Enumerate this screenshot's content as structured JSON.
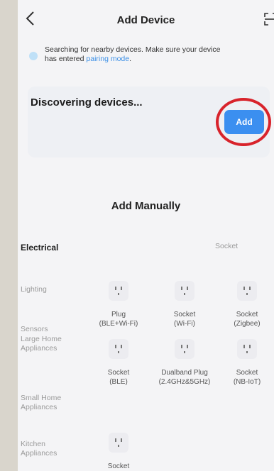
{
  "header": {
    "title": "Add Device"
  },
  "notice": {
    "text_prefix": "Searching for nearby devices. Make sure your device",
    "text_line2_prefix": "has entered ",
    "link": "pairing mode",
    "text_line2_suffix": "."
  },
  "discovery": {
    "title": "Discovering devices...",
    "add_label": "Add"
  },
  "manual": {
    "title": "Add Manually",
    "selected_category": "Electrical",
    "section_header": "Socket"
  },
  "categories": [
    {
      "label": "Lighting"
    },
    {
      "label": "Sensors"
    },
    {
      "label": "Large Home Appliances"
    },
    {
      "label": "Small Home Appliances"
    },
    {
      "label": "Kitchen Appliances"
    }
  ],
  "devices": [
    {
      "name": "Plug",
      "sub": "(BLE+Wi-Fi)"
    },
    {
      "name": "Socket",
      "sub": "(Wi-Fi)"
    },
    {
      "name": "Socket",
      "sub": "(Zigbee)"
    },
    {
      "name": "Socket",
      "sub": "(BLE)"
    },
    {
      "name": "Dualband Plug",
      "sub": "(2.4GHz&5GHz)"
    },
    {
      "name": "Socket",
      "sub": "(NB-IoT)"
    },
    {
      "name": "Socket",
      "sub": ""
    }
  ],
  "icons": {
    "back": "chevron-left-icon",
    "scan": "scan-icon",
    "plug": "plug-socket-icon"
  },
  "colors": {
    "accent": "#3b8ff0",
    "highlight_circle": "#d8232b"
  }
}
